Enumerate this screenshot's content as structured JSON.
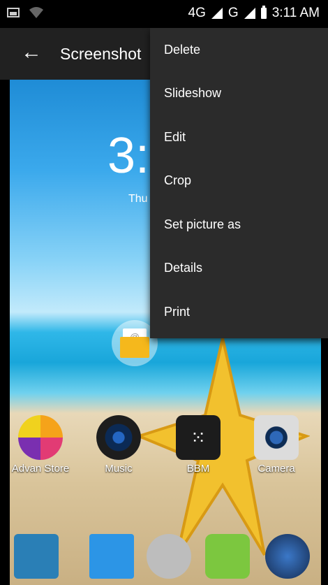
{
  "status": {
    "network": "4G",
    "network2": "G",
    "time": "3:11 AM"
  },
  "appbar": {
    "title": "Screenshot"
  },
  "wallpaper": {
    "clock": "3:",
    "day": "Thu"
  },
  "menu": {
    "items": [
      {
        "label": "Delete"
      },
      {
        "label": "Slideshow"
      },
      {
        "label": "Edit"
      },
      {
        "label": "Crop"
      },
      {
        "label": "Set picture as"
      },
      {
        "label": "Details"
      },
      {
        "label": "Print"
      }
    ]
  },
  "apps": [
    {
      "label": "Advan Store"
    },
    {
      "label": "Music"
    },
    {
      "label": "BBM"
    },
    {
      "label": "Camera"
    }
  ],
  "email_widget": {
    "glyph": "@"
  },
  "bottom_dock": [
    "phone-icon",
    "contacts-icon",
    "apps-drawer-icon",
    "messaging-icon",
    "browser-icon"
  ]
}
